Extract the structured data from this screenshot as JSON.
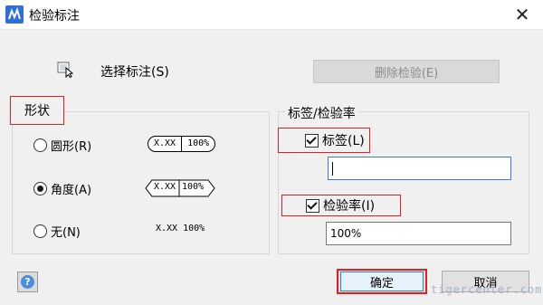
{
  "window": {
    "title": "检验标注",
    "close_glyph": "✕"
  },
  "top": {
    "select_label": "选择标注(S)",
    "delete_label": "删除检验(E)"
  },
  "shape_group": {
    "legend": "形状",
    "options": [
      {
        "label": "圆形(R)",
        "checked": false,
        "preview_left": "X.XX",
        "preview_right": "100%"
      },
      {
        "label": "角度(A)",
        "checked": true,
        "preview_left": "X.XX",
        "preview_right": "100%"
      },
      {
        "label": "无(N)",
        "checked": false,
        "preview_text": "X.XX 100%"
      }
    ]
  },
  "label_group": {
    "legend": "标签/检验率",
    "label_checkbox": "标签(L)",
    "label_checked": true,
    "label_value": "",
    "rate_checkbox": "检验率(I)",
    "rate_checked": true,
    "rate_value": "100%"
  },
  "footer": {
    "help_glyph": "?",
    "ok_label": "确定",
    "cancel_label": "取消"
  },
  "watermark": "tigercenter.com",
  "colors": {
    "highlight_red": "#e02020",
    "focus_blue": "#3a7bd5"
  }
}
